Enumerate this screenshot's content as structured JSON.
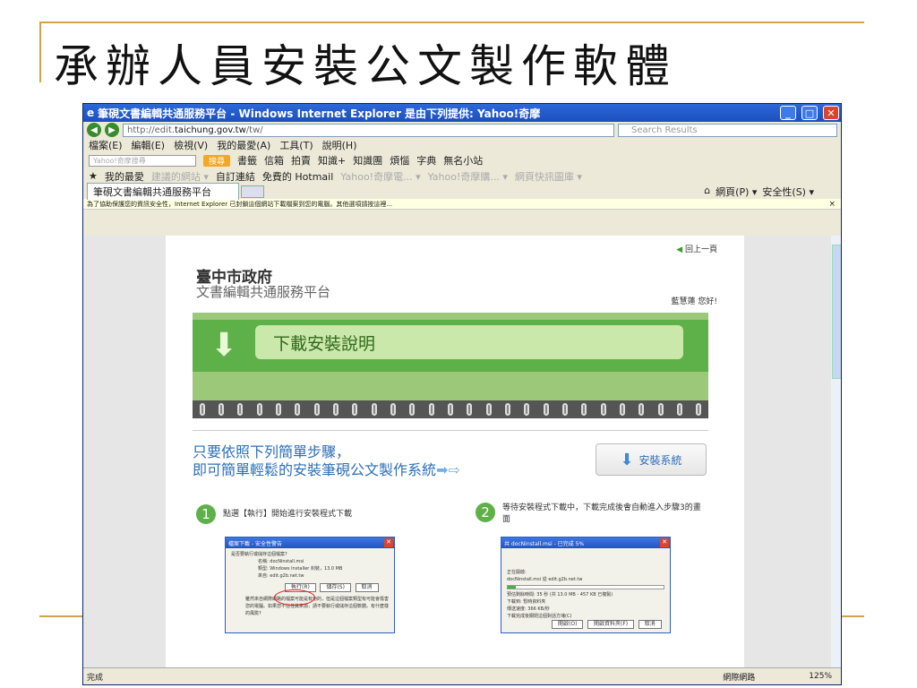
{
  "slide": {
    "title": "承辦人員安裝公文製作軟體"
  },
  "window": {
    "title": "筆硯文書編輯共通服務平台 - Windows Internet Explorer 是由下列提供: Yahoo!奇摩",
    "address_prefix": "http://edit.",
    "address_host": "taichung.gov.tw",
    "address_suffix": "/tw/",
    "search_placeholder": "Search Results",
    "menu": [
      "檔案(E)",
      "編輯(E)",
      "檢視(V)",
      "我的最愛(A)",
      "工具(T)",
      "說明(H)"
    ],
    "toolbar": {
      "search_box": "Yahoo!奇摩搜尋",
      "search_btn": "搜尋",
      "items": [
        "書籤",
        "信箱",
        "拍賣",
        "知識+",
        "知識團",
        "煩惱",
        "字典",
        "無名小站"
      ]
    },
    "favorites": {
      "label": "我的最愛",
      "items": [
        "建議的網站 ▾",
        "自訂連結",
        "免費的 Hotmail",
        "Yahoo!奇摩電... ▾",
        "Yahoo!奇摩購... ▾",
        "網頁快訊圖庫 ▾"
      ]
    },
    "tab": {
      "label": "筆硯文書編輯共通服務平台",
      "page_menu": "網頁(P) ▾",
      "safety_menu": "安全性(S) ▾"
    },
    "infobar": "為了協助保護您的資訊安全性，Internet Explorer 已封鎖這個網站下載檔案到您的電腦。其他選項請按這裡...",
    "status": {
      "left": "完成",
      "zone": "網際網路",
      "zoom": "125%"
    }
  },
  "page": {
    "back": "回上一頁",
    "gov": "臺中市政府",
    "platform": "文書編輯共通服務平台",
    "hello": "藍慧蓮 您好!",
    "banner": "下載安裝說明",
    "instr_line1": "只要依照下列簡單步驟，",
    "instr_line2": "即可簡單輕鬆的安裝筆硯公文製作系統",
    "install_button": "安裝系統",
    "step1": {
      "num": "1",
      "text": "點選【執行】開始進行安裝程式下載"
    },
    "step2": {
      "num": "2",
      "text": "等待安裝程式下載中，下載完成後會自動進入步驟3的畫面"
    },
    "dialog1": {
      "title": "檔案下載 - 安全性警告",
      "question": "是否要執行或儲存這個檔案?",
      "name": "名稱: docNinstall.msi",
      "type": "類型: Windows Installer 封裝，13.0 MB",
      "from": "來自: edit.g2b.net.tw",
      "run": "執行(R)",
      "save": "儲存(S)",
      "cancel": "取消",
      "warning": "雖然來自網際網路的檔案可能是有用的，但是這個檔案類型有可能會傷害您的電腦。如果您不信任其來源，請不要執行或儲存這個軟體。有什麼樣的風險?"
    },
    "dialog2": {
      "title": "共 docNinstall.msi - 已完成 5%",
      "opening": "正在開啟:",
      "file": "docNinstall.msi 從 edit.g2b.net.tw",
      "eta": "預估剩餘時間:  35 秒 (共 13.0 MB - 457 KB 已複製)",
      "dest": "下載到:  暫時資料夾",
      "rate": "傳送速度:  366 KB/秒",
      "close_check": "下載完成後關閉這個對話方塊(C)",
      "open": "開啟(O)",
      "open_folder": "開啟資料夾(F)",
      "cancel": "取消"
    }
  },
  "colors": {
    "green": "#5eb048",
    "blue": "#2d6fb8",
    "gold": "#d4a24c"
  }
}
